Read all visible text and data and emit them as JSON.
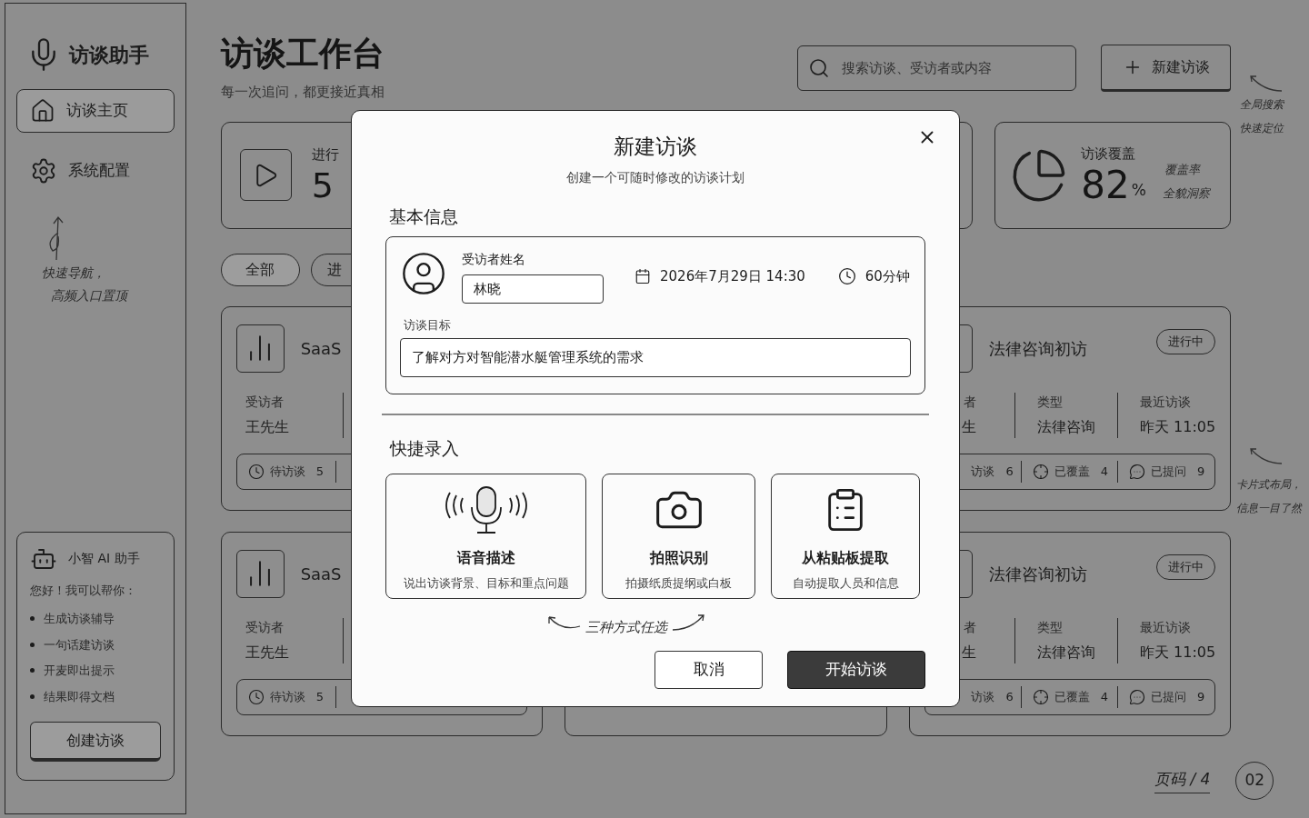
{
  "sidebar": {
    "app_name": "访谈助手",
    "nav": [
      {
        "label": "访谈主页",
        "selected": true
      },
      {
        "label": "系统配置",
        "selected": false
      }
    ],
    "note": [
      "快速导航，",
      "高频入口置顶"
    ],
    "assistant": {
      "title": "小智 AI 助手",
      "greeting": "您好！我可以帮你：",
      "items": [
        "生成访谈辅导",
        "一句话建访谈",
        "开麦即出提示",
        "结果即得文档"
      ],
      "button": "创建访谈"
    }
  },
  "header": {
    "title": "访谈工作台",
    "subtitle": "每一次追问，都更接近真相",
    "search": {
      "placeholder": "搜索访谈、受访者或内容"
    },
    "new_button": "新建访谈"
  },
  "stats": [
    {
      "kind": "play",
      "label": "进行",
      "value": "5"
    },
    {
      "kind": "covered"
    },
    {
      "kind": "pie",
      "label": "访谈覆盖",
      "value": "82",
      "unit": "%",
      "notes": [
        "覆盖率",
        "全貌洞察"
      ]
    }
  ],
  "filters": [
    {
      "label": "全部",
      "selected": true
    },
    {
      "label": "进",
      "selected": false
    }
  ],
  "interviews": [
    {
      "kind": "cut_right",
      "title": "SaaS",
      "fields": [
        {
          "label": "受访者",
          "value": "王先生"
        }
      ],
      "footer": [
        {
          "label": "待访谈",
          "count": "5"
        }
      ]
    },
    {
      "kind": "cut_left",
      "title": "法律咨询初访",
      "badge": "进行中",
      "fields": [
        {
          "label": "者",
          "value": "生"
        },
        {
          "label": "类型",
          "value": "法律咨询"
        },
        {
          "label": "最近访谈",
          "value": "昨天 11:05"
        }
      ],
      "footer": [
        {
          "label": "访谈",
          "count": "6"
        },
        {
          "label": "已覆盖",
          "count": "4"
        },
        {
          "label": "已提问",
          "count": "9"
        }
      ]
    },
    {
      "kind": "cut_right",
      "title": "SaaS",
      "fields": [
        {
          "label": "受访者",
          "value": "王先生"
        }
      ],
      "footer": [
        {
          "label": "待访谈",
          "count": "5"
        }
      ]
    },
    {
      "kind": "covered"
    },
    {
      "kind": "cut_left",
      "title": "法律咨询初访",
      "badge": "进行中",
      "fields": [
        {
          "label": "者",
          "value": "生"
        },
        {
          "label": "类型",
          "value": "法律咨询"
        },
        {
          "label": "最近访谈",
          "value": "昨天 11:05"
        }
      ],
      "footer": [
        {
          "label": "访谈",
          "count": "6"
        },
        {
          "label": "已覆盖",
          "count": "4"
        },
        {
          "label": "已提问",
          "count": "9"
        }
      ]
    }
  ],
  "annotations": {
    "search": [
      "全局搜索",
      "快速定位"
    ],
    "cards": [
      "卡片式布局，",
      "信息一目了然"
    ]
  },
  "pager": {
    "label": "页码 / 4",
    "page": "02"
  },
  "dialog": {
    "title": "新建访谈",
    "subtitle": "创建一个可随时修改的访谈计划",
    "basic_heading": "基本信息",
    "name_label": "受访者姓名",
    "name_value": "林晓",
    "datetime": "2026年7月29日 14:30",
    "duration": "60分钟",
    "goal_label": "访谈目标",
    "goal_value": "了解对方对智能潜水艇管理系统的需求",
    "quick_heading": "快捷录入",
    "options": [
      {
        "title": "语音描述",
        "desc": "说出访谈背景、目标和重点问题"
      },
      {
        "title": "拍照识别",
        "desc": "拍摄纸质提纲或白板"
      },
      {
        "title": "从粘贴板提取",
        "desc": "自动提取人员和信息"
      }
    ],
    "hint": "三种方式任选",
    "cancel": "取消",
    "start": "开始访谈"
  }
}
